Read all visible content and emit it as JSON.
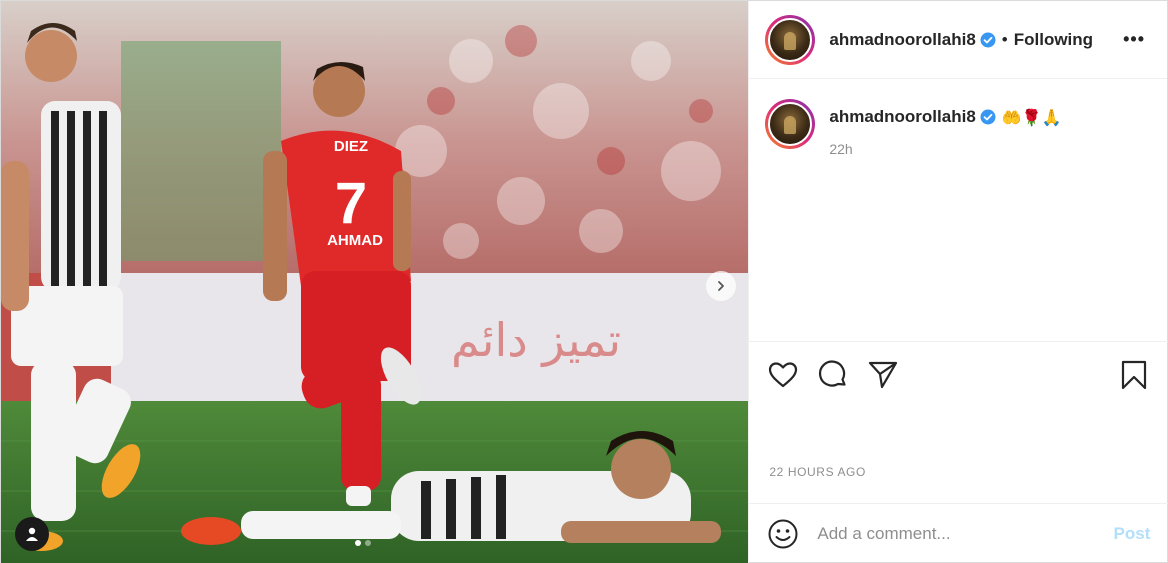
{
  "post": {
    "media": {
      "image_description_icon": "photo-carousel",
      "next_icon": "chevron-right-icon",
      "tag_icon": "user-tag-icon",
      "page_dots": [
        true,
        false
      ],
      "jersey_name": "DIEZ",
      "jersey_number": "7",
      "jersey_back_name": "AHMAD",
      "banner_text": "تميز دائم"
    },
    "header": {
      "username": "ahmadnoorollahi8",
      "separator": "•",
      "follow_status": "Following",
      "more_label": "•••"
    },
    "caption": {
      "username": "ahmadnoorollahi8",
      "text": "🤲🌹🙏",
      "time": "22h"
    },
    "actions": {
      "like_icon": "heart-icon",
      "comment_icon": "comment-icon",
      "share_icon": "share-icon",
      "save_icon": "bookmark-icon"
    },
    "posted_time": "22 HOURS AGO",
    "comment": {
      "placeholder": "Add a comment...",
      "post_label": "Post"
    },
    "colors": {
      "verified": "#3897f0",
      "post_button": "#b2dffc",
      "muted": "#8e8e8e"
    }
  }
}
